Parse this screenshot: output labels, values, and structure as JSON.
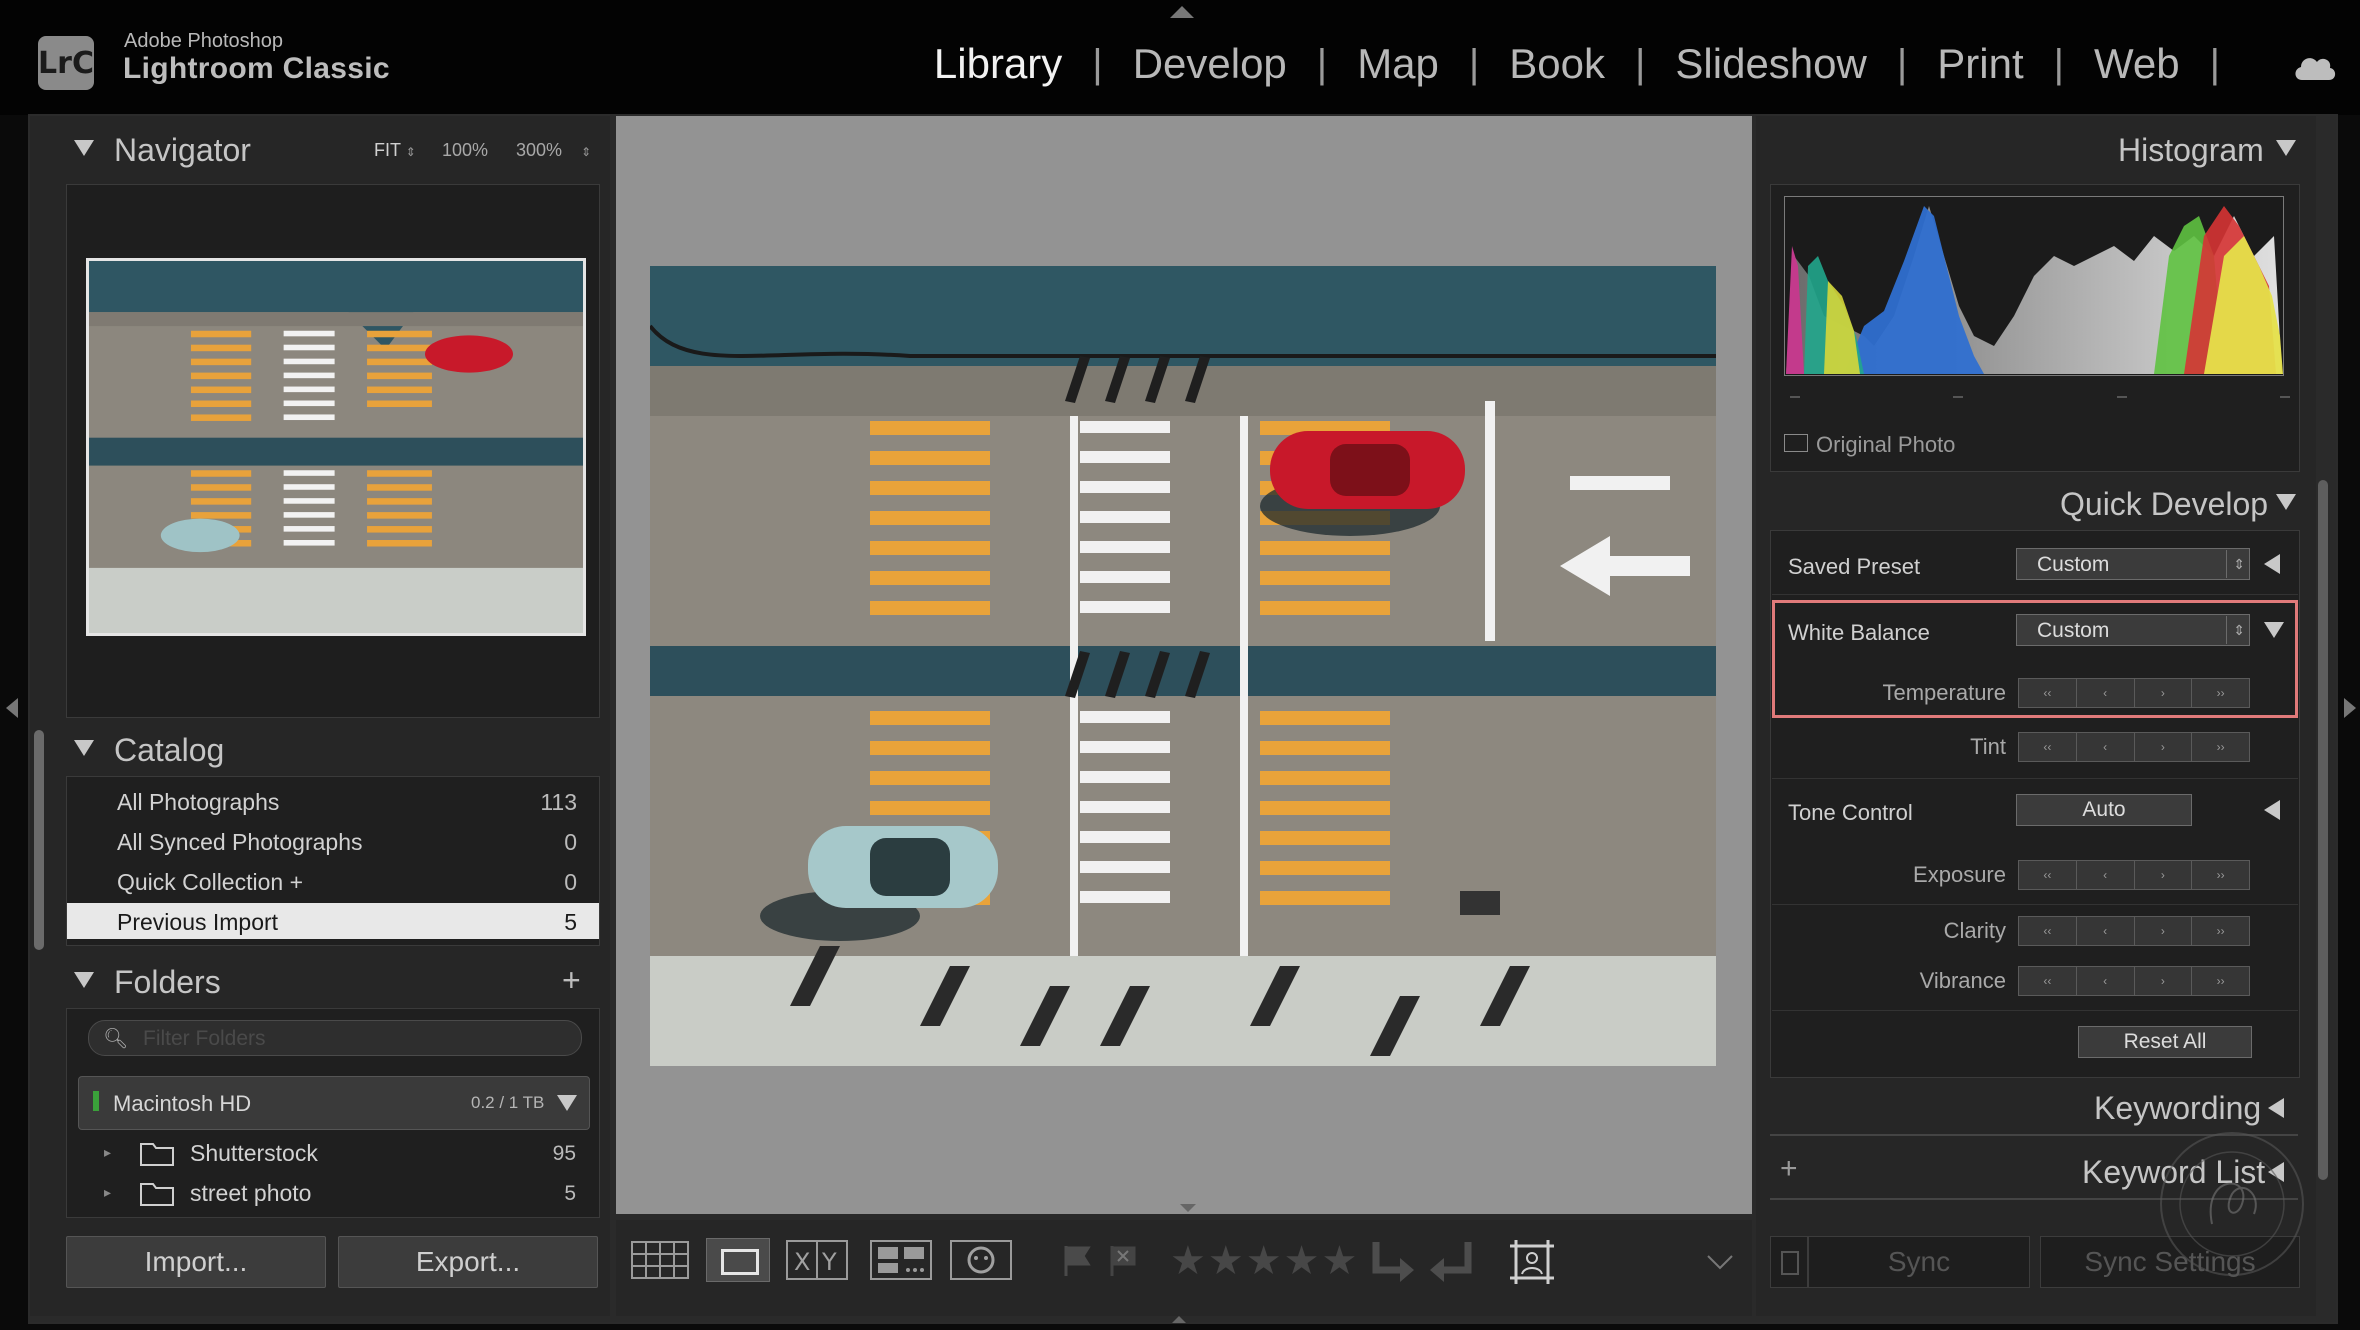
{
  "app": {
    "brand_top": "Adobe Photoshop",
    "brand_name": "Lightroom Classic",
    "logo_text": "LrC"
  },
  "modules": [
    "Library",
    "Develop",
    "Map",
    "Book",
    "Slideshow",
    "Print",
    "Web"
  ],
  "active_module": "Library",
  "navigator": {
    "title": "Navigator",
    "zoom_fit": "FIT",
    "zoom_100": "100%",
    "zoom_300": "300%"
  },
  "catalog": {
    "title": "Catalog",
    "items": [
      {
        "label": "All Photographs",
        "count": "113"
      },
      {
        "label": "All Synced Photographs",
        "count": "0"
      },
      {
        "label": "Quick Collection +",
        "count": "0"
      },
      {
        "label": "Previous Import",
        "count": "5"
      }
    ]
  },
  "folders": {
    "title": "Folders",
    "filter_placeholder": "Filter Folders",
    "volume": {
      "name": "Macintosh HD",
      "usage": "0.2 / 1 TB"
    },
    "items": [
      {
        "label": "Shutterstock",
        "count": "95"
      },
      {
        "label": "street photo",
        "count": "5"
      }
    ]
  },
  "buttons": {
    "import": "Import...",
    "export": "Export..."
  },
  "histogram": {
    "title": "Histogram",
    "original_photo": "Original Photo"
  },
  "quick_develop": {
    "title": "Quick Develop",
    "saved_preset_label": "Saved Preset",
    "saved_preset_value": "Custom",
    "white_balance_label": "White Balance",
    "white_balance_value": "Custom",
    "temperature": "Temperature",
    "tint": "Tint",
    "tone_control": "Tone Control",
    "auto": "Auto",
    "exposure": "Exposure",
    "clarity": "Clarity",
    "vibrance": "Vibrance",
    "reset_all": "Reset All"
  },
  "keywording": {
    "title": "Keywording"
  },
  "keyword_list": {
    "title": "Keyword List"
  },
  "sync": {
    "sync": "Sync",
    "sync_settings": "Sync Settings"
  },
  "colors": {
    "highlight": "#e07a7a",
    "active_row": "#e8e8e8"
  }
}
